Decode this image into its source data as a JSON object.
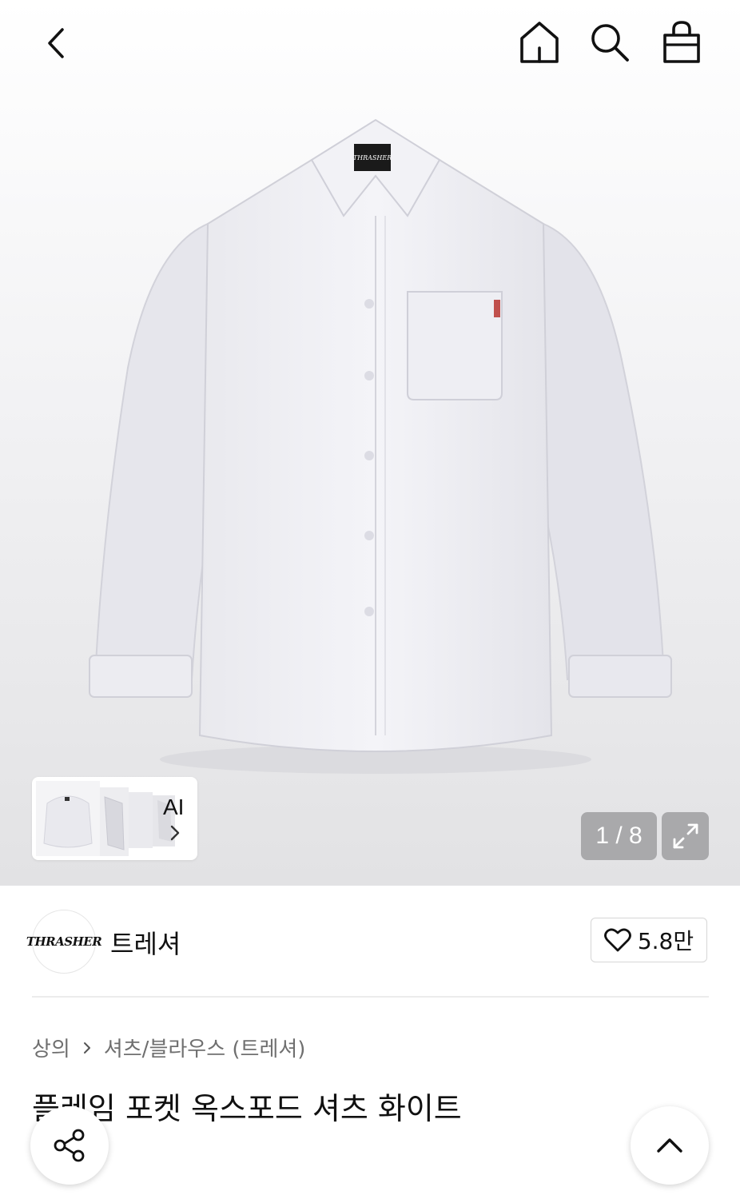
{
  "header": {
    "icons": [
      "back-icon",
      "home-icon",
      "search-icon",
      "bag-icon"
    ]
  },
  "gallery": {
    "ai_label": "AI",
    "page_counter": "1 / 8",
    "current_page": 1,
    "total_pages": 8
  },
  "brand": {
    "logo_text": "THRASHER",
    "name": "트레셔",
    "like_count": "5.8만"
  },
  "breadcrumb": {
    "category": "상의",
    "subcategory": "셔츠/블라우스 (트레셔)"
  },
  "product": {
    "title": "플레임 포켓 옥스포드 셔츠 화이트"
  },
  "colors": {
    "page_counter_bg": "#a9a9ab",
    "hero_bg": "#ececee"
  }
}
